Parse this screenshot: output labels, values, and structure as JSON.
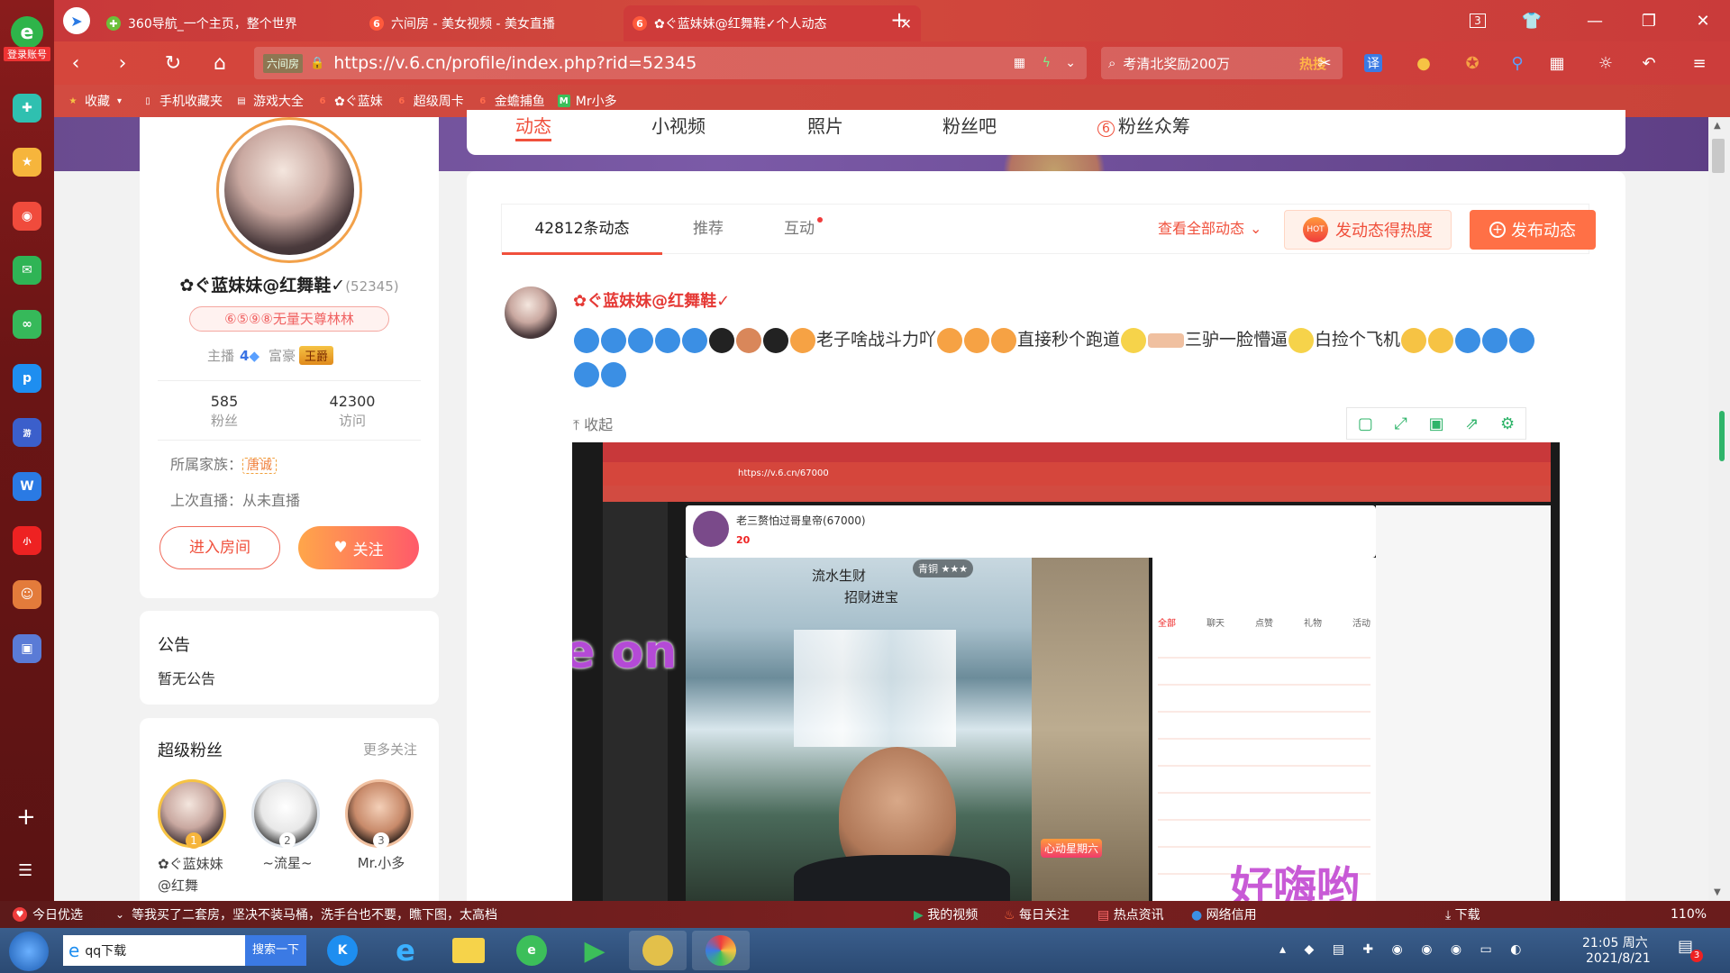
{
  "browser": {
    "login_label": "登录账号",
    "tabs": [
      {
        "label": "360导航_一个主页，整个世界",
        "active": false
      },
      {
        "label": "六间房 - 美女视频 - 美女直播",
        "active": false
      },
      {
        "label": "✿ぐ蓝妹妹@红舞鞋✓个人动态",
        "active": true
      }
    ],
    "new_tab": "+",
    "tab_count": "3",
    "url": "https://v.6.cn/profile/index.php?rid=52345",
    "url_badge": "六间房",
    "search_text": "考清北奖励200万",
    "search_hot": "热搜",
    "translate_label": "译"
  },
  "bookmarks": [
    {
      "label": "收藏",
      "color": "#f6c344"
    },
    {
      "label": "手机收藏夹",
      "color": "#ffffff"
    },
    {
      "label": "游戏大全",
      "color": "#ffffff"
    },
    {
      "label": "✿ぐ蓝妹",
      "color": "#ff5a3c"
    },
    {
      "label": "超级周卡",
      "color": "#ff5a3c"
    },
    {
      "label": "金蟾捕鱼",
      "color": "#ff5a3c"
    },
    {
      "label": "Mr小多",
      "color": "#3cbf5a"
    }
  ],
  "profile_nav": {
    "tabs": [
      "动态",
      "小视频",
      "照片",
      "粉丝吧",
      "粉丝众筹"
    ],
    "active": "动态"
  },
  "profile": {
    "name": "✿ぐ蓝妹妹@红舞鞋✓",
    "rid": "(52345)",
    "badge_text": "⑥⑤⑨⑧无量天尊林林",
    "anchor_label": "主播",
    "anchor_level": "4",
    "rich_label": "富豪",
    "rich_level": "王爵",
    "fans_count": "585",
    "fans_label": "粉丝",
    "visit_count": "42300",
    "visit_label": "访问",
    "family_label": "所属家族：",
    "family_name": "唐诚",
    "last_live": "上次直播：从未直播",
    "enter_room": "进入房间",
    "follow": "关注"
  },
  "notice": {
    "title": "公告",
    "content": "暂无公告"
  },
  "super_fans": {
    "title": "超级粉丝",
    "more": "更多关注",
    "fans": [
      {
        "rank": "1",
        "name": "✿ぐ蓝妹妹@红舞",
        "color": "#f6b53c"
      },
      {
        "rank": "2",
        "name": "~流星~",
        "color": "#b7c4d6"
      },
      {
        "rank": "3",
        "name": "Mr.小多",
        "color": "#d9875a"
      }
    ]
  },
  "feed_tabs": {
    "count_tab": "42812条动态",
    "recommend": "推荐",
    "interact": "互动",
    "view_all": "查看全部动态",
    "hot_button": "发动态得热度",
    "publish": "发布动态"
  },
  "post": {
    "author": "✿ぐ蓝妹妹@红舞鞋✓",
    "text_1": "老子啥战斗力吖",
    "text_2": "直接秒个跑道",
    "text_3": "三驴一脸懵逼",
    "text_4": "白捡个飞机",
    "collapse": "收起"
  },
  "video": {
    "subtitle_left": "哟 哟Come on",
    "subtitle_right": "好嗨哟",
    "inner_url": "https://v.6.cn/67000",
    "inner_host": "老三赘怕过哥皇帝(67000)",
    "inner_calligraphy_1": "流水生财",
    "inner_calligraphy_2": "招财进宝",
    "inner_badge": "青铜",
    "inner_heart": "心动星期六",
    "inner_level": "20",
    "inner_chat_tabs": [
      "全部",
      "聊天",
      "点赞",
      "礼物",
      "活动"
    ]
  },
  "statusbar": {
    "left_label": "今日优选",
    "news": "等我买了二套房，坚决不装马桶，洗手台也不要，瞧下图，太高档",
    "items": [
      "我的视频",
      "每日关注",
      "热点资讯",
      "网络信用"
    ],
    "download": "下载",
    "zoom": "110%"
  },
  "taskbar": {
    "search_app": "qq下载",
    "search_btn": "搜索一下",
    "time": "21:05 周六",
    "date": "2021/8/21",
    "notif": "3"
  },
  "colors": {
    "accent": "#f0503c",
    "publish": "#ff7046",
    "title_red": "#e53935"
  }
}
